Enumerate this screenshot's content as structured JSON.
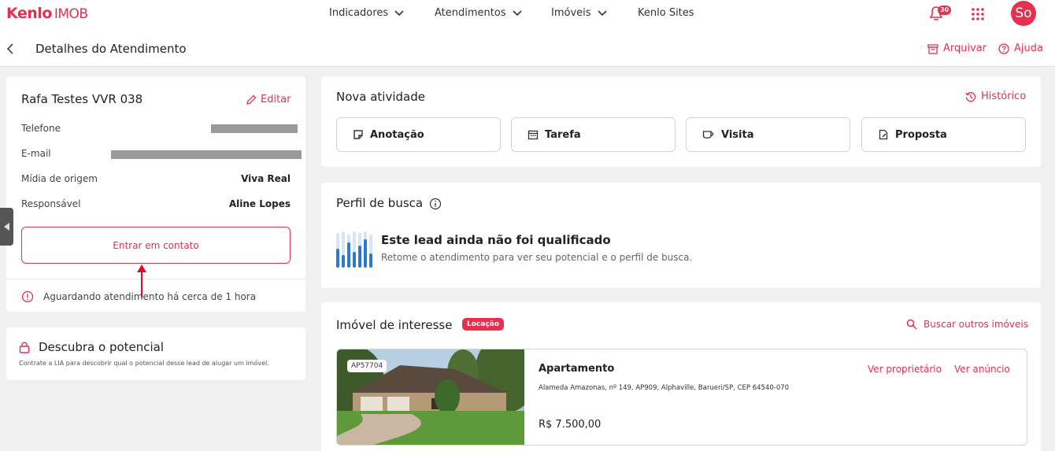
{
  "header": {
    "logo_brand": "Kenlo",
    "logo_suffix": "IMOB",
    "nav": [
      {
        "label": "Indicadores"
      },
      {
        "label": "Atendimentos"
      },
      {
        "label": "Imóveis"
      },
      {
        "label": "Kenlo Sites"
      }
    ],
    "notifications_count": "30",
    "avatar_initials": "So",
    "accent_color": "#e5304f"
  },
  "subheader": {
    "title": "Detalhes do Atendimento",
    "archive_label": "Arquivar",
    "help_label": "Ajuda"
  },
  "contact": {
    "name": "Rafa Testes VVR 038",
    "edit_label": "Editar",
    "fields": [
      {
        "label": "Telefone",
        "value": ""
      },
      {
        "label": "E-mail",
        "value": ""
      },
      {
        "label": "Mídia de origem",
        "value": "Viva Real"
      },
      {
        "label": "Responsável",
        "value": "Aline Lopes"
      }
    ],
    "contact_button": "Entrar em contato",
    "status_text": "Aguardando atendimento há cerca de 1 hora"
  },
  "potential": {
    "title": "Descubra o potencial",
    "subtitle": "Contrate a LIA para descobrir qual o potencial desse lead de alugar um imóvel."
  },
  "new_activity": {
    "title": "Nova atividade",
    "history_label": "Histórico",
    "actions": [
      {
        "label": "Anotação",
        "icon": "note-icon"
      },
      {
        "label": "Tarefa",
        "icon": "calendar-icon"
      },
      {
        "label": "Visita",
        "icon": "coffee-icon"
      },
      {
        "label": "Proposta",
        "icon": "document-icon"
      }
    ]
  },
  "search_profile": {
    "title": "Perfil de busca",
    "lead_title": "Este lead ainda não foi qualificado",
    "lead_subtitle": "Retome o atendimento para ver seu potencial e o perfil de busca."
  },
  "property_interest": {
    "title": "Imóvel de interesse",
    "tag": "Locação",
    "search_label": "Buscar outros imóveis",
    "property": {
      "code": "AP57704",
      "type": "Apartamento",
      "address": "Alameda Amazonas, nº 149, AP909, Alphaville, Barueri/SP, CEP 64540-070",
      "price": "R$ 7.500,00",
      "owner_link": "Ver proprietário",
      "listing_link": "Ver anúncio"
    }
  }
}
